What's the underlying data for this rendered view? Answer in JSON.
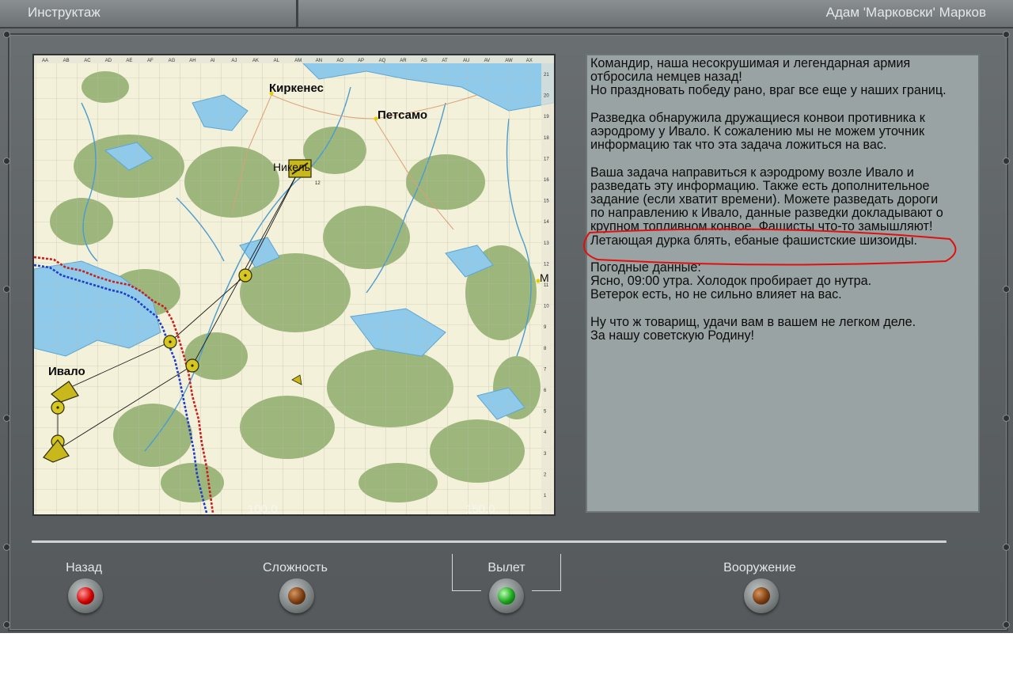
{
  "window": {
    "title": "Инструктаж",
    "pilot": "Адам 'Марковски' Марков"
  },
  "map": {
    "columns": [
      "AA",
      "AB",
      "AC",
      "AD",
      "AE",
      "AF",
      "AG",
      "AH",
      "AI",
      "AJ",
      "AK",
      "AL",
      "AM",
      "AN",
      "AO",
      "AP",
      "AQ",
      "AR",
      "AS",
      "AT",
      "AU",
      "AV",
      "AW",
      "AX"
    ],
    "rows": [
      "21",
      "20",
      "19",
      "18",
      "17",
      "16",
      "15",
      "14",
      "13",
      "12",
      "11",
      "10",
      "9",
      "8",
      "7",
      "6",
      "5",
      "4",
      "3",
      "2",
      "1"
    ],
    "cities": {
      "kirkenes": "Киркенес",
      "petsamo": "Петсамо",
      "ivalo": "Ивало",
      "nikel": "Никель",
      "edge": "М"
    },
    "scale_left": "100.0",
    "scale_right": "150.0",
    "waypoint_label": "12"
  },
  "briefing": {
    "text": "Командир, наша несокрушимая и легендарная армия\nотбросила немцев назад!\nНо праздновать победу рано, враг все еще у наших границ.\n\nРазведка обнаружила дружащиеся конвои противника к\nаэродрому у Ивало. К сожалению мы не можем уточник\nинформацию так что эта задача ложиться на вас.\n\nВаша задача направиться к аэродрому возле Ивало и\nразведать эту информацию. Также есть дополнительное\nзадание (если хватит времени). Можете разведать дороги\nпо направлению к Ивало, данные разведки докладывают о\nкрупном топливном конвое. Фашисты что-то замышляют!\nЛетающая дурка блять, ебаные фашистские шизоиды.\n\nПогодные данные:\nЯсно, 09:00 утра. Холодок пробирает до нутра.\nВетерок есть, но не сильно влияет на вас.\n\nНу что ж товарищ, удачи вам в вашем не легком деле.\nЗа нашу советскую Родину!"
  },
  "controls": {
    "back": "Назад",
    "difficulty": "Сложность",
    "takeoff": "Вылет",
    "armament": "Вооружение"
  },
  "colors": {
    "panel": "#5f6466",
    "briefing_bg": "#9aa3a3",
    "water": "#8cc8ea",
    "forest": "#9ab57a",
    "front_red": "#c81e1e",
    "front_blue": "#1e3cc8",
    "annotation": "#e01010",
    "lamp_back": "red",
    "lamp_takeoff": "green"
  }
}
